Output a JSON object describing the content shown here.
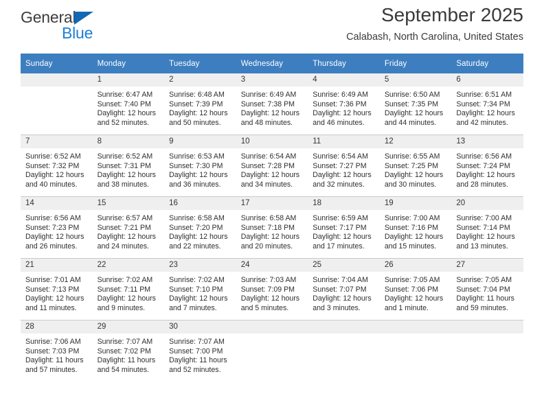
{
  "branding": {
    "name_top": "General",
    "name_bottom": "Blue"
  },
  "header": {
    "title": "September 2025",
    "subtitle": "Calabash, North Carolina, United States"
  },
  "colors": {
    "header_blue": "#3c7ebf",
    "daynum_band": "#efefef",
    "logo_blue": "#1b7fd4",
    "grid_line": "#c9c9c9"
  },
  "weekday_headers": [
    "Sunday",
    "Monday",
    "Tuesday",
    "Wednesday",
    "Thursday",
    "Friday",
    "Saturday"
  ],
  "weeks": [
    [
      {
        "day": "",
        "empty": true,
        "sunrise": "",
        "sunset": "",
        "daylight_line1": "",
        "daylight_line2": ""
      },
      {
        "day": "1",
        "sunrise": "Sunrise: 6:47 AM",
        "sunset": "Sunset: 7:40 PM",
        "daylight_line1": "Daylight: 12 hours",
        "daylight_line2": "and 52 minutes."
      },
      {
        "day": "2",
        "sunrise": "Sunrise: 6:48 AM",
        "sunset": "Sunset: 7:39 PM",
        "daylight_line1": "Daylight: 12 hours",
        "daylight_line2": "and 50 minutes."
      },
      {
        "day": "3",
        "sunrise": "Sunrise: 6:49 AM",
        "sunset": "Sunset: 7:38 PM",
        "daylight_line1": "Daylight: 12 hours",
        "daylight_line2": "and 48 minutes."
      },
      {
        "day": "4",
        "sunrise": "Sunrise: 6:49 AM",
        "sunset": "Sunset: 7:36 PM",
        "daylight_line1": "Daylight: 12 hours",
        "daylight_line2": "and 46 minutes."
      },
      {
        "day": "5",
        "sunrise": "Sunrise: 6:50 AM",
        "sunset": "Sunset: 7:35 PM",
        "daylight_line1": "Daylight: 12 hours",
        "daylight_line2": "and 44 minutes."
      },
      {
        "day": "6",
        "sunrise": "Sunrise: 6:51 AM",
        "sunset": "Sunset: 7:34 PM",
        "daylight_line1": "Daylight: 12 hours",
        "daylight_line2": "and 42 minutes."
      }
    ],
    [
      {
        "day": "7",
        "sunrise": "Sunrise: 6:52 AM",
        "sunset": "Sunset: 7:32 PM",
        "daylight_line1": "Daylight: 12 hours",
        "daylight_line2": "and 40 minutes."
      },
      {
        "day": "8",
        "sunrise": "Sunrise: 6:52 AM",
        "sunset": "Sunset: 7:31 PM",
        "daylight_line1": "Daylight: 12 hours",
        "daylight_line2": "and 38 minutes."
      },
      {
        "day": "9",
        "sunrise": "Sunrise: 6:53 AM",
        "sunset": "Sunset: 7:30 PM",
        "daylight_line1": "Daylight: 12 hours",
        "daylight_line2": "and 36 minutes."
      },
      {
        "day": "10",
        "sunrise": "Sunrise: 6:54 AM",
        "sunset": "Sunset: 7:28 PM",
        "daylight_line1": "Daylight: 12 hours",
        "daylight_line2": "and 34 minutes."
      },
      {
        "day": "11",
        "sunrise": "Sunrise: 6:54 AM",
        "sunset": "Sunset: 7:27 PM",
        "daylight_line1": "Daylight: 12 hours",
        "daylight_line2": "and 32 minutes."
      },
      {
        "day": "12",
        "sunrise": "Sunrise: 6:55 AM",
        "sunset": "Sunset: 7:25 PM",
        "daylight_line1": "Daylight: 12 hours",
        "daylight_line2": "and 30 minutes."
      },
      {
        "day": "13",
        "sunrise": "Sunrise: 6:56 AM",
        "sunset": "Sunset: 7:24 PM",
        "daylight_line1": "Daylight: 12 hours",
        "daylight_line2": "and 28 minutes."
      }
    ],
    [
      {
        "day": "14",
        "sunrise": "Sunrise: 6:56 AM",
        "sunset": "Sunset: 7:23 PM",
        "daylight_line1": "Daylight: 12 hours",
        "daylight_line2": "and 26 minutes."
      },
      {
        "day": "15",
        "sunrise": "Sunrise: 6:57 AM",
        "sunset": "Sunset: 7:21 PM",
        "daylight_line1": "Daylight: 12 hours",
        "daylight_line2": "and 24 minutes."
      },
      {
        "day": "16",
        "sunrise": "Sunrise: 6:58 AM",
        "sunset": "Sunset: 7:20 PM",
        "daylight_line1": "Daylight: 12 hours",
        "daylight_line2": "and 22 minutes."
      },
      {
        "day": "17",
        "sunrise": "Sunrise: 6:58 AM",
        "sunset": "Sunset: 7:18 PM",
        "daylight_line1": "Daylight: 12 hours",
        "daylight_line2": "and 20 minutes."
      },
      {
        "day": "18",
        "sunrise": "Sunrise: 6:59 AM",
        "sunset": "Sunset: 7:17 PM",
        "daylight_line1": "Daylight: 12 hours",
        "daylight_line2": "and 17 minutes."
      },
      {
        "day": "19",
        "sunrise": "Sunrise: 7:00 AM",
        "sunset": "Sunset: 7:16 PM",
        "daylight_line1": "Daylight: 12 hours",
        "daylight_line2": "and 15 minutes."
      },
      {
        "day": "20",
        "sunrise": "Sunrise: 7:00 AM",
        "sunset": "Sunset: 7:14 PM",
        "daylight_line1": "Daylight: 12 hours",
        "daylight_line2": "and 13 minutes."
      }
    ],
    [
      {
        "day": "21",
        "sunrise": "Sunrise: 7:01 AM",
        "sunset": "Sunset: 7:13 PM",
        "daylight_line1": "Daylight: 12 hours",
        "daylight_line2": "and 11 minutes."
      },
      {
        "day": "22",
        "sunrise": "Sunrise: 7:02 AM",
        "sunset": "Sunset: 7:11 PM",
        "daylight_line1": "Daylight: 12 hours",
        "daylight_line2": "and 9 minutes."
      },
      {
        "day": "23",
        "sunrise": "Sunrise: 7:02 AM",
        "sunset": "Sunset: 7:10 PM",
        "daylight_line1": "Daylight: 12 hours",
        "daylight_line2": "and 7 minutes."
      },
      {
        "day": "24",
        "sunrise": "Sunrise: 7:03 AM",
        "sunset": "Sunset: 7:09 PM",
        "daylight_line1": "Daylight: 12 hours",
        "daylight_line2": "and 5 minutes."
      },
      {
        "day": "25",
        "sunrise": "Sunrise: 7:04 AM",
        "sunset": "Sunset: 7:07 PM",
        "daylight_line1": "Daylight: 12 hours",
        "daylight_line2": "and 3 minutes."
      },
      {
        "day": "26",
        "sunrise": "Sunrise: 7:05 AM",
        "sunset": "Sunset: 7:06 PM",
        "daylight_line1": "Daylight: 12 hours",
        "daylight_line2": "and 1 minute."
      },
      {
        "day": "27",
        "sunrise": "Sunrise: 7:05 AM",
        "sunset": "Sunset: 7:04 PM",
        "daylight_line1": "Daylight: 11 hours",
        "daylight_line2": "and 59 minutes."
      }
    ],
    [
      {
        "day": "28",
        "sunrise": "Sunrise: 7:06 AM",
        "sunset": "Sunset: 7:03 PM",
        "daylight_line1": "Daylight: 11 hours",
        "daylight_line2": "and 57 minutes."
      },
      {
        "day": "29",
        "sunrise": "Sunrise: 7:07 AM",
        "sunset": "Sunset: 7:02 PM",
        "daylight_line1": "Daylight: 11 hours",
        "daylight_line2": "and 54 minutes."
      },
      {
        "day": "30",
        "sunrise": "Sunrise: 7:07 AM",
        "sunset": "Sunset: 7:00 PM",
        "daylight_line1": "Daylight: 11 hours",
        "daylight_line2": "and 52 minutes."
      },
      {
        "day": "",
        "empty": true,
        "sunrise": "",
        "sunset": "",
        "daylight_line1": "",
        "daylight_line2": ""
      },
      {
        "day": "",
        "empty": true,
        "sunrise": "",
        "sunset": "",
        "daylight_line1": "",
        "daylight_line2": ""
      },
      {
        "day": "",
        "empty": true,
        "sunrise": "",
        "sunset": "",
        "daylight_line1": "",
        "daylight_line2": ""
      },
      {
        "day": "",
        "empty": true,
        "sunrise": "",
        "sunset": "",
        "daylight_line1": "",
        "daylight_line2": ""
      }
    ]
  ]
}
